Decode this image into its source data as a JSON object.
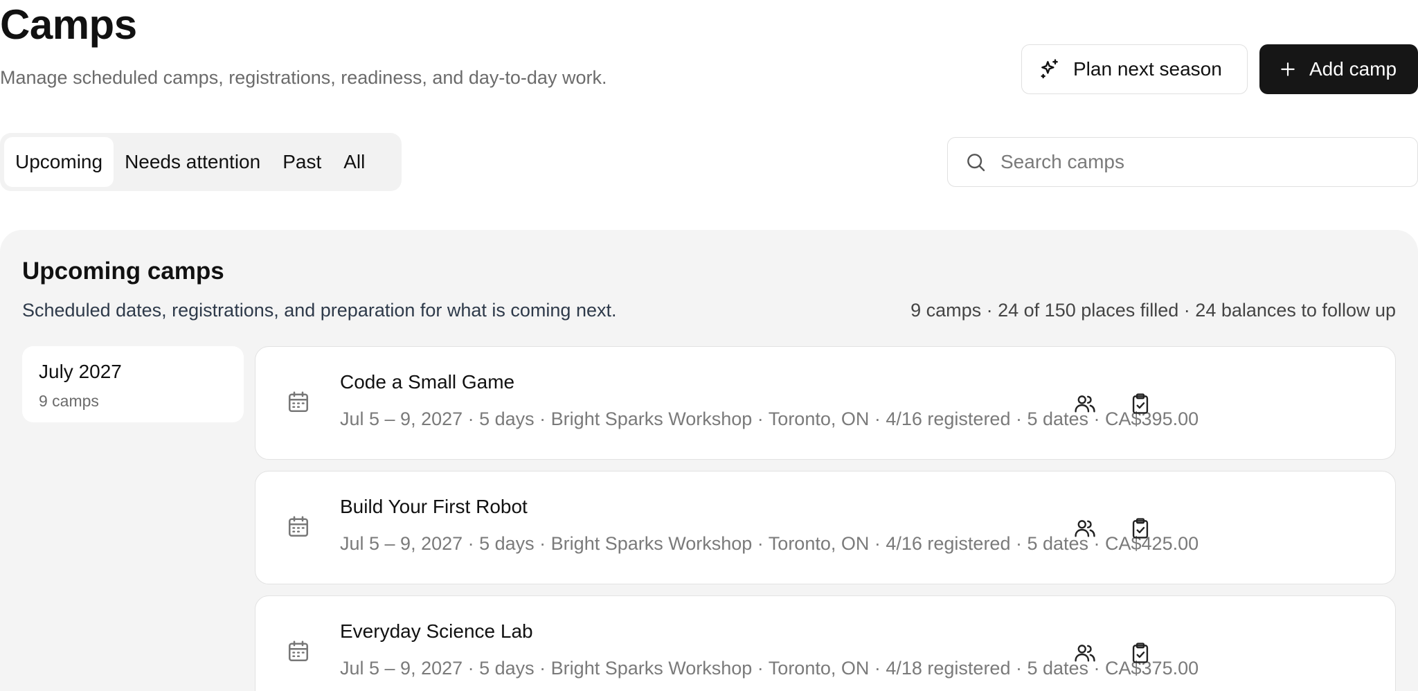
{
  "header": {
    "title": "Camps",
    "subtitle": "Manage scheduled camps, registrations, readiness, and day-to-day work."
  },
  "actions": {
    "plan_label": "Plan next season",
    "plan_icon": "sparkles-icon",
    "add_label": "Add camp",
    "add_icon": "plus-icon"
  },
  "tabs": [
    {
      "label": "Upcoming",
      "active": true
    },
    {
      "label": "Needs attention",
      "active": false
    },
    {
      "label": "Past",
      "active": false
    },
    {
      "label": "All",
      "active": false
    }
  ],
  "search": {
    "placeholder": "Search camps",
    "value": ""
  },
  "panel": {
    "title": "Upcoming camps",
    "subtitle": "Scheduled dates, registrations, and preparation for what is coming next.",
    "summary": "9 camps · 24 of 150 places filled · 24 balances to follow up"
  },
  "month_group": {
    "name": "July 2027",
    "count": "9 camps"
  },
  "camps": [
    {
      "name": "Code a Small Game",
      "meta": "Jul 5 – 9, 2027 · 5 days · Bright Sparks Workshop · Toronto, ON · 4/16 registered · 5 dates · CA$395.00"
    },
    {
      "name": "Build Your First Robot",
      "meta": "Jul 5 – 9, 2027 · 5 days · Bright Sparks Workshop · Toronto, ON · 4/16 registered · 5 dates · CA$425.00"
    },
    {
      "name": "Everyday Science Lab",
      "meta": "Jul 5 – 9, 2027 · 5 days · Bright Sparks Workshop · Toronto, ON · 4/18 registered · 5 dates · CA$375.00"
    }
  ],
  "colors": {
    "primary_button": "#161616",
    "panel_background": "#f4f4f4",
    "muted_text": "#7a7a7a"
  }
}
